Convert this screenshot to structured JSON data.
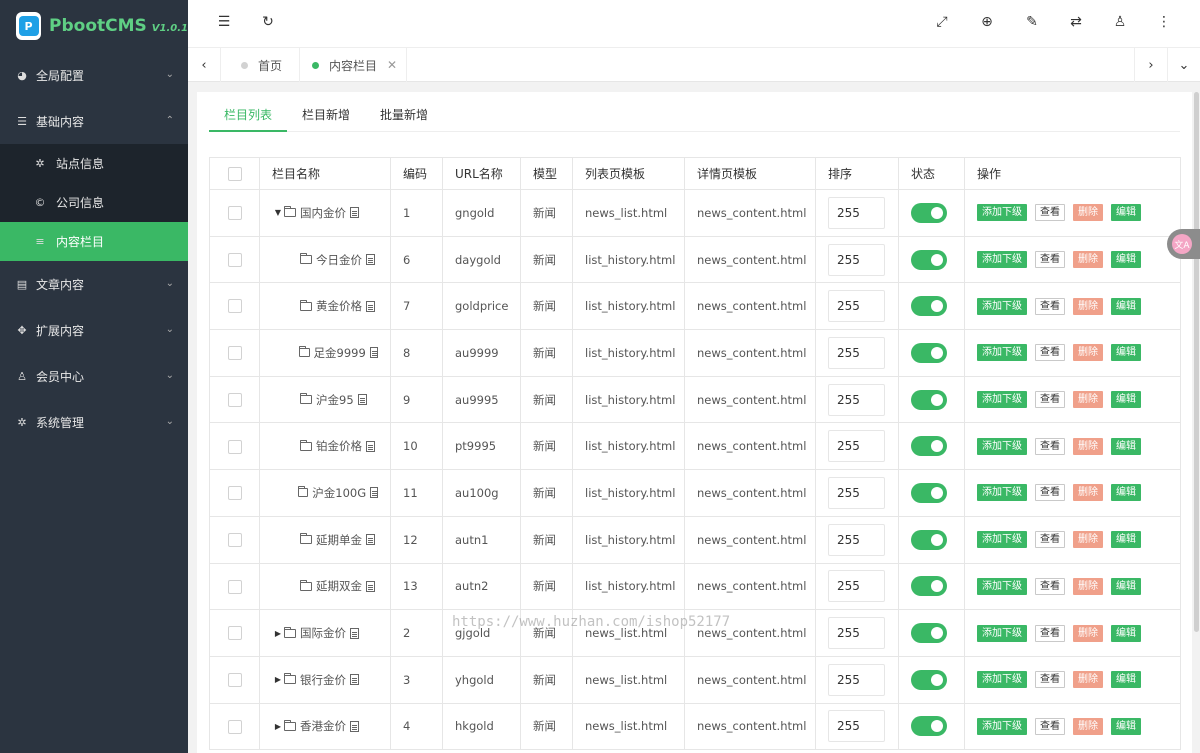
{
  "app": {
    "logo_glyph": "P",
    "name": "PbootCMS",
    "version": "V1.0.1"
  },
  "sidebar": {
    "items": [
      {
        "label": "全局配置",
        "icon": "dashboard-icon",
        "glyph": "◕",
        "expanded": false
      },
      {
        "label": "基础内容",
        "icon": "sliders-icon",
        "glyph": "☰",
        "expanded": true,
        "children": [
          {
            "label": "站点信息",
            "icon": "gear-icon",
            "glyph": "✲",
            "active": false
          },
          {
            "label": "公司信息",
            "icon": "copyright-icon",
            "glyph": "©",
            "active": false
          },
          {
            "label": "内容栏目",
            "icon": "list-icon",
            "glyph": "≡",
            "active": true
          }
        ]
      },
      {
        "label": "文章内容",
        "icon": "file-icon",
        "glyph": "▤",
        "expanded": false
      },
      {
        "label": "扩展内容",
        "icon": "puzzle-icon",
        "glyph": "✥",
        "expanded": false
      },
      {
        "label": "会员中心",
        "icon": "user-icon",
        "glyph": "♙",
        "expanded": false
      },
      {
        "label": "系统管理",
        "icon": "cog-icon",
        "glyph": "✲",
        "expanded": false
      }
    ]
  },
  "topbar": {
    "icons": [
      {
        "name": "menu-toggle-icon",
        "glyph": "☰"
      },
      {
        "name": "refresh-icon",
        "glyph": "↻"
      },
      {
        "name": "fullscreen-icon",
        "glyph": "⤢"
      },
      {
        "name": "globe-icon",
        "glyph": "⊕"
      },
      {
        "name": "clear-cache-icon",
        "glyph": "✎"
      },
      {
        "name": "translate-icon",
        "glyph": "⇄"
      },
      {
        "name": "user-icon",
        "glyph": "♙"
      },
      {
        "name": "more-icon",
        "glyph": "⋮"
      }
    ]
  },
  "tabstrip": {
    "prev_glyph": "‹",
    "next_glyph": "›",
    "dropdown_glyph": "⌄",
    "tabs": [
      {
        "label": "首页",
        "active": false,
        "closable": false
      },
      {
        "label": "内容栏目",
        "active": true,
        "closable": true,
        "close_glyph": "✕"
      }
    ]
  },
  "content_tabs": [
    {
      "label": "栏目列表",
      "active": true
    },
    {
      "label": "栏目新增",
      "active": false
    },
    {
      "label": "批量新增",
      "active": false
    }
  ],
  "table": {
    "columns": [
      "栏目名称",
      "编码",
      "URL名称",
      "模型",
      "列表页模板",
      "详情页模板",
      "排序",
      "状态",
      "操作"
    ],
    "actions": {
      "add": "添加下级",
      "view": "查看",
      "delete": "删除",
      "edit": "编辑"
    },
    "rows": [
      {
        "name": "国内金价",
        "level": 0,
        "tree": "expanded",
        "code": "1",
        "url": "gngold",
        "model": "新闻",
        "list_tpl": "news_list.html",
        "detail_tpl": "news_content.html",
        "sort": "255",
        "status": true
      },
      {
        "name": "今日金价",
        "level": 1,
        "tree": "none",
        "code": "6",
        "url": "daygold",
        "model": "新闻",
        "list_tpl": "list_history.html",
        "detail_tpl": "news_content.html",
        "sort": "255",
        "status": true
      },
      {
        "name": "黄金价格",
        "level": 1,
        "tree": "none",
        "code": "7",
        "url": "goldprice",
        "model": "新闻",
        "list_tpl": "list_history.html",
        "detail_tpl": "news_content.html",
        "sort": "255",
        "status": true
      },
      {
        "name": "足金9999",
        "level": 1,
        "tree": "none",
        "code": "8",
        "url": "au9999",
        "model": "新闻",
        "list_tpl": "list_history.html",
        "detail_tpl": "news_content.html",
        "sort": "255",
        "status": true
      },
      {
        "name": "沪金95",
        "level": 1,
        "tree": "none",
        "code": "9",
        "url": "au9995",
        "model": "新闻",
        "list_tpl": "list_history.html",
        "detail_tpl": "news_content.html",
        "sort": "255",
        "status": true
      },
      {
        "name": "铂金价格",
        "level": 1,
        "tree": "none",
        "code": "10",
        "url": "pt9995",
        "model": "新闻",
        "list_tpl": "list_history.html",
        "detail_tpl": "news_content.html",
        "sort": "255",
        "status": true
      },
      {
        "name": "沪金100G",
        "level": 1,
        "tree": "none",
        "code": "11",
        "url": "au100g",
        "model": "新闻",
        "list_tpl": "list_history.html",
        "detail_tpl": "news_content.html",
        "sort": "255",
        "status": true
      },
      {
        "name": "延期单金",
        "level": 1,
        "tree": "none",
        "code": "12",
        "url": "autn1",
        "model": "新闻",
        "list_tpl": "list_history.html",
        "detail_tpl": "news_content.html",
        "sort": "255",
        "status": true
      },
      {
        "name": "延期双金",
        "level": 1,
        "tree": "none",
        "code": "13",
        "url": "autn2",
        "model": "新闻",
        "list_tpl": "list_history.html",
        "detail_tpl": "news_content.html",
        "sort": "255",
        "status": true
      },
      {
        "name": "国际金价",
        "level": 0,
        "tree": "collapsed",
        "code": "2",
        "url": "gjgold",
        "model": "新闻",
        "list_tpl": "news_list.html",
        "detail_tpl": "news_content.html",
        "sort": "255",
        "status": true
      },
      {
        "name": "银行金价",
        "level": 0,
        "tree": "collapsed",
        "code": "3",
        "url": "yhgold",
        "model": "新闻",
        "list_tpl": "news_list.html",
        "detail_tpl": "news_content.html",
        "sort": "255",
        "status": true
      },
      {
        "name": "香港金价",
        "level": 0,
        "tree": "collapsed",
        "code": "4",
        "url": "hkgold",
        "model": "新闻",
        "list_tpl": "news_list.html",
        "detail_tpl": "news_content.html",
        "sort": "255",
        "status": true
      }
    ]
  },
  "watermark": "https://www.huzhan.com/ishop52177",
  "float_widget": {
    "glyph": "文A"
  },
  "colors": {
    "sidebar_bg": "#2b3440",
    "accent": "#3ab865",
    "danger": "#f0a08a"
  }
}
